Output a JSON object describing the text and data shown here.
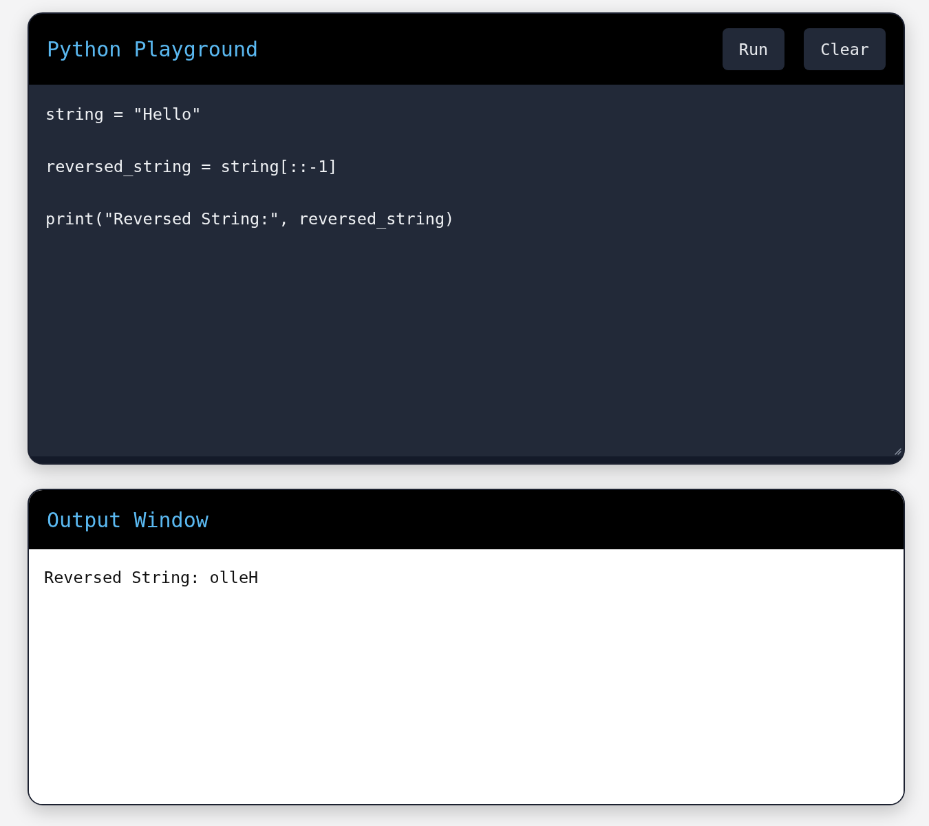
{
  "editor_panel": {
    "title": "Python Playground",
    "buttons": [
      {
        "label": "Run"
      },
      {
        "label": "Clear"
      }
    ],
    "code_lines": [
      "string = \"Hello\"",
      "reversed_string = string[::-1]",
      "print(\"Reversed String:\", reversed_string)"
    ]
  },
  "output_panel": {
    "title": "Output Window",
    "lines": [
      "Reversed String: olleH"
    ]
  }
}
